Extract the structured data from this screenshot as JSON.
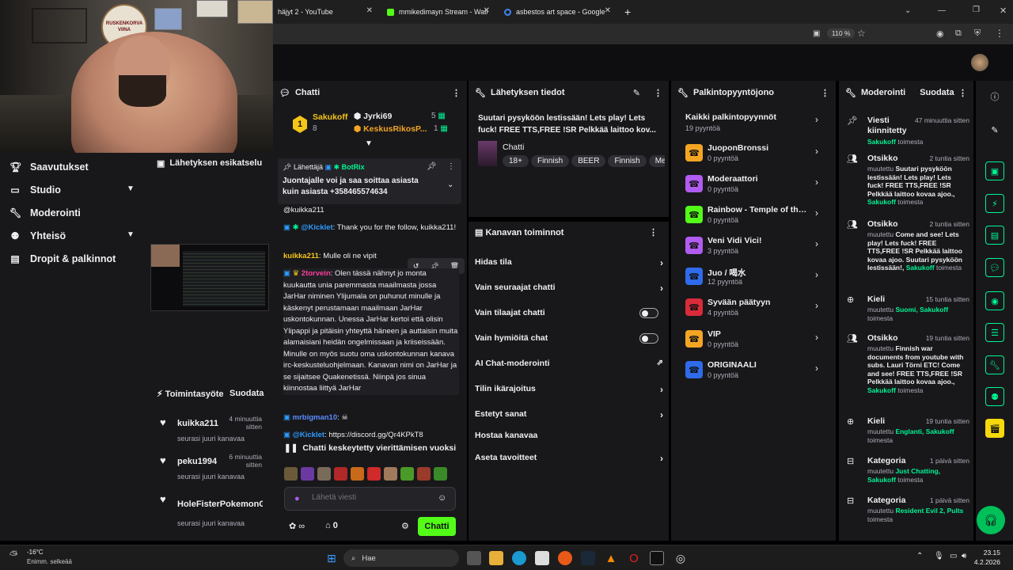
{
  "browser": {
    "tabs": [
      {
        "title": "häjyt 2 - YouTube",
        "icon": "youtube-icon"
      },
      {
        "title": "mmikedimayn Stream - Watch L",
        "icon": "kick-icon"
      },
      {
        "title": "asbestos art space - Google-ha",
        "icon": "google-icon"
      }
    ],
    "new_tab": "+",
    "zoom": "110 %"
  },
  "webcam": {
    "sign_text": "RUSKENKORVA VIINA"
  },
  "leftnav": {
    "items": [
      {
        "label": "Saavutukset",
        "icon": "trophy-icon"
      },
      {
        "label": "Studio",
        "icon": "studio-icon",
        "chevron": true
      },
      {
        "label": "Moderointi",
        "icon": "wrench-icon"
      },
      {
        "label": "Yhteisö",
        "icon": "community-icon",
        "chevron": true
      },
      {
        "label": "Dropit & palkinnot",
        "icon": "drops-icon"
      }
    ]
  },
  "preview": {
    "title": "Lähetyksen esikatselu"
  },
  "activity": {
    "title": "Toimintasyöte",
    "filter": "Suodata",
    "items": [
      {
        "name": "kuikka211",
        "time": "4 minuuttia sitten",
        "sub": "seurasi juuri kanavaa"
      },
      {
        "name": "peku1994",
        "time": "6 minuuttia sitten",
        "sub": "seurasi juuri kanavaa"
      },
      {
        "name": "HoleFisterPokemonG",
        "time": "",
        "sub": "seurasi juuri kanavaa"
      }
    ]
  },
  "chat": {
    "title": "Chatti",
    "leaderboard": [
      {
        "rank": "1",
        "name": "Sakukoff",
        "count": "8"
      },
      {
        "name": "Jyrki69",
        "count": "5"
      },
      {
        "name": "KeskusRikosP...",
        "count": "1"
      }
    ],
    "pinned": {
      "sender_label": "Lähettäjä",
      "sender": "BotRix",
      "text": "Juontajalle voi ja saa soittaa asiasta kuin asiasta +358465574634"
    },
    "messages": [
      {
        "user": "",
        "text": "@kuikka211"
      },
      {
        "user": "@Kicklet",
        "text": "Thank you for the follow, kuikka211!"
      },
      {
        "user": "kuikka211",
        "text": "Mulle oli ne vipit"
      },
      {
        "user": "2torvein",
        "text": "Olen tässä nähnyt jo monta kuukautta unia paremmasta maailmasta jossa JarHar niminen Ylijumala on puhunut minulle ja käskenyt perustamaan maailmaan JarHar uskontokunnan. Unessa JarHar kertoi että olisin Ylipappi ja pitäisin yhteyttä häneen ja auttaisin muita alamaisiani heidän ongelmissaan ja kriiseissään. Minulle on myös suotu oma uskontokunnan kanava irc-keskusteluohjelmaan. Kanavan nimi on JarHar ja se sijaitsee Quakenetissä. Niinpä jos sinua kiinnostaa liittyä JarHar"
      },
      {
        "user": "mrbigman10",
        "text": ""
      },
      {
        "user": "@Kicklet",
        "text": "https://discord.gg/Qr4KPkT8"
      }
    ],
    "paused": "Chatti keskeytetty vierittämisen vuoksi",
    "input_placeholder": "Lähetä viesti",
    "points": "0",
    "send": "Chatti"
  },
  "stream_info": {
    "title": "Lähetyksen tiedot",
    "stream_title": "Suutari pysyköön lestissään! Lets play! Lets fuck! FREE TTS,FREE !SR Pelkkää laittoo kov...",
    "category": "Chatti",
    "tags": [
      "18+",
      "Finnish",
      "BEER",
      "Finnish",
      "Me"
    ]
  },
  "channel_actions": {
    "title": "Kanavan toiminnot",
    "items": [
      {
        "label": "Hidas tila",
        "control": "arrow"
      },
      {
        "label": "Vain seuraajat chatti",
        "control": "arrow"
      },
      {
        "label": "Vain tilaajat chatti",
        "control": "toggle",
        "on": false
      },
      {
        "label": "Vain hymiöitä chat",
        "control": "toggle",
        "on": false
      },
      {
        "label": "AI Chat-moderointi",
        "control": "external"
      },
      {
        "label": "Tilin ikärajoitus",
        "control": "arrow"
      },
      {
        "label": "Estetyt sanat",
        "control": "arrow"
      },
      {
        "label": "Hostaa kanavaa",
        "control": "none"
      },
      {
        "label": "Aseta tavoitteet",
        "control": "arrow"
      }
    ]
  },
  "rewards": {
    "title": "Palkintopyyntöjono",
    "all_label": "Kaikki palkintopyynnöt",
    "all_count": "19 pyyntöä",
    "items": [
      {
        "name": "JuoponBronssi",
        "count": "0 pyyntöä",
        "color": "#f5a524"
      },
      {
        "name": "Moderaattori",
        "count": "0 pyyntöä",
        "color": "#b05cf0"
      },
      {
        "name": "Rainbow - Temple of the...",
        "count": "0 pyyntöä",
        "color": "#53fc18"
      },
      {
        "name": "Veni Vidi Vici!",
        "count": "3 pyyntöä",
        "color": "#b05cf0"
      },
      {
        "name": "Juo / 喝水",
        "count": "12 pyyntöä",
        "color": "#2f6bea"
      },
      {
        "name": "Syvään päätyyn",
        "count": "4 pyyntöä",
        "color": "#d92b3a"
      },
      {
        "name": "VIP",
        "count": "0 pyyntöä",
        "color": "#f5a524"
      },
      {
        "name": "ORIGINAALI",
        "count": "0 pyyntöä",
        "color": "#2f6bea"
      }
    ]
  },
  "moderation": {
    "title": "Moderointi",
    "filter": "Suodata",
    "items": [
      {
        "type": "Viesti kiinnitetty",
        "time": "47 minuuttia sitten",
        "icon": "pin-icon",
        "pre": "",
        "highlight": "Sakukoff",
        "post": " toimesta"
      },
      {
        "type": "Otsikko",
        "time": "2 tuntia sitten",
        "icon": "people-icon",
        "pre": "muutettu ",
        "bold": "Suutari pysyköön lestissään! Lets play! Lets fuck! FREE TTS,FREE !SR Pelkkää laittoo kovaa ajoo.,",
        "highlight": "Sakukoff",
        "post": " toimesta"
      },
      {
        "type": "Otsikko",
        "time": "2 tuntia sitten",
        "icon": "people-icon",
        "pre": "muutettu ",
        "bold": "Come and see! Lets play! Lets fuck! FREE TTS,FREE !SR Pelkkää laittoo kovaa ajoo. Suutari pysyköön lestissään!,",
        "highlight": "Sakukoff",
        "post": " toimesta"
      },
      {
        "type": "Kieli",
        "time": "15 tuntia sitten",
        "icon": "globe-icon",
        "pre": "muutettu ",
        "highlight": "Suomi, Sakukoff",
        "post": " toimesta"
      },
      {
        "type": "Otsikko",
        "time": "19 tuntia sitten",
        "icon": "people-icon",
        "pre": "muutettu ",
        "bold": "Finnish war documents from youtube with subs. Lauri Törni ETC! Come and see! FREE TTS,FREE !SR Pelkkää laittoo kovaa ajoo.,",
        "highlight": "Sakukoff",
        "post": " toimesta"
      },
      {
        "type": "Kieli",
        "time": "19 tuntia sitten",
        "icon": "globe-icon",
        "pre": "muutettu ",
        "highlight": "Englanti, Sakukoff",
        "post": " toimesta"
      },
      {
        "type": "Kategoria",
        "time": "1 päivä sitten",
        "icon": "category-icon",
        "pre": "muutettu ",
        "highlight": "Just Chatting, Sakukoff",
        "post": " toimesta"
      },
      {
        "type": "Kategoria",
        "time": "1 päivä sitten",
        "icon": "category-icon",
        "pre": "muutettu ",
        "highlight": "Resident Evil 2, Pults",
        "post": " toimesta"
      }
    ]
  },
  "taskbar": {
    "weather_temp": "-16°C",
    "weather_desc": "Enimm. selkeää",
    "search": "Hae",
    "time": "23.15",
    "date": "4.2.2026"
  },
  "colors": {
    "accent": "#53fc18",
    "panel": "#18181b",
    "bg": "#0e0e10"
  }
}
